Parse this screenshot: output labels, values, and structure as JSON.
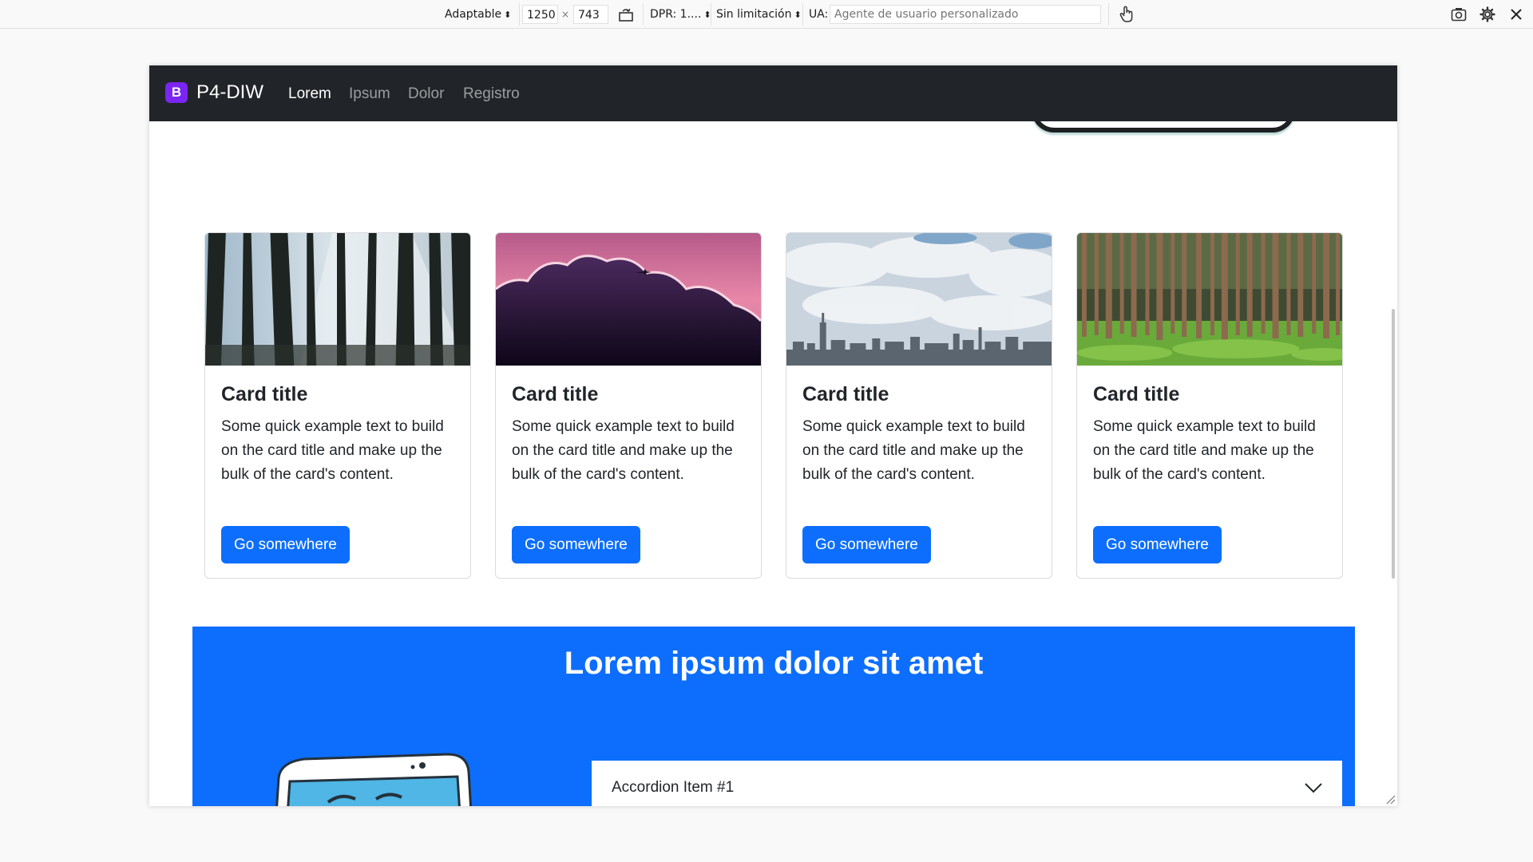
{
  "rdm": {
    "device": "Adaptable",
    "width": "1250",
    "times": "×",
    "height": "743",
    "dpr": "DPR: 1....",
    "throttling": "Sin limitación",
    "ua_label": "UA:",
    "ua_placeholder": "Agente de usuario personalizado"
  },
  "site": {
    "brand_logo": "B",
    "brand_name": "P4-DIW",
    "nav": [
      "Lorem",
      "Ipsum",
      "Dolor",
      "Registro"
    ],
    "cards": [
      {
        "title": "Card title",
        "text": "Some quick example text to build on the card title and make up the bulk of the card's content.",
        "button": "Go somewhere",
        "image": "forest-sunlight"
      },
      {
        "title": "Card title",
        "text": "Some quick example text to build on the card title and make up the bulk of the card's content.",
        "button": "Go somewhere",
        "image": "pink-sky-clouds-airplane"
      },
      {
        "title": "Card title",
        "text": "Some quick example text to build on the card title and make up the bulk of the card's content.",
        "button": "Go somewhere",
        "image": "city-skyline-clouds"
      },
      {
        "title": "Card title",
        "text": "Some quick example text to build on the card title and make up the bulk of the card's content.",
        "button": "Go somewhere",
        "image": "pine-forest-green"
      }
    ],
    "section_title": "Lorem ipsum dolor sit amet",
    "accordion": {
      "item1": "Accordion Item #1"
    }
  },
  "colors": {
    "navbar": "#212529",
    "brand": "#7b25f2",
    "primary": "#0d6efd"
  }
}
